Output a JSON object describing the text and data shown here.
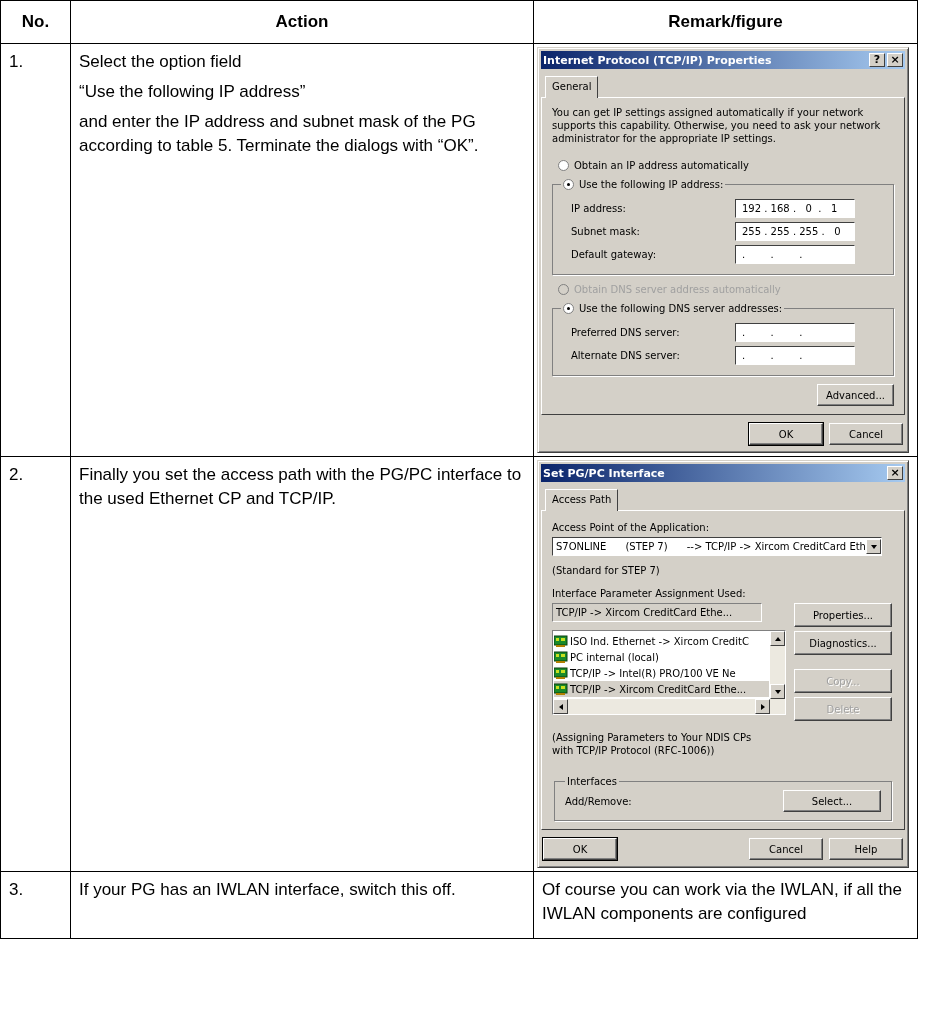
{
  "table": {
    "columns": [
      "No.",
      "Action",
      "Remark/figure"
    ],
    "rows": [
      {
        "no": "1.",
        "action": [
          "Select the option field",
          "“Use the following IP address”",
          "and enter the IP address and subnet mask of the PG according to table 5. Terminate the dialogs with “OK”."
        ],
        "figure": {
          "kind": "ip_dialog",
          "title": "Internet Protocol (TCP/IP) Properties",
          "help_button": "?",
          "close_button": "×",
          "tabs": [
            {
              "label": "General",
              "selected": true
            }
          ],
          "description": "You can get IP settings assigned automatically if your network supports this capability. Otherwise, you need to ask your network administrator for the appropriate IP settings.",
          "ip_options": [
            {
              "label": "Obtain an IP address automatically",
              "selected": false,
              "disabled": false
            },
            {
              "label": "Use the following IP address:",
              "selected": true,
              "disabled": false,
              "fields": [
                {
                  "label": "IP address:",
                  "value": "192 . 168 .   0  .   1"
                },
                {
                  "label": "Subnet mask:",
                  "value": "255 . 255 . 255 .   0"
                },
                {
                  "label": "Default gateway:",
                  "value": ".        .        ."
                }
              ]
            }
          ],
          "dns_options": [
            {
              "label": "Obtain DNS server address automatically",
              "selected": false,
              "disabled": true
            },
            {
              "label": "Use the following DNS server addresses:",
              "selected": true,
              "disabled": false,
              "fields": [
                {
                  "label": "Preferred DNS server:",
                  "value": ".        .        ."
                },
                {
                  "label": "Alternate DNS server:",
                  "value": ".        .        ."
                }
              ]
            }
          ],
          "advanced_button": "Advanced...",
          "ok_button": "OK",
          "cancel_button": "Cancel"
        }
      },
      {
        "no": "2.",
        "action": [
          "Finally you set the access path with the PG/PC interface to the used Ethernet CP and TCP/IP."
        ],
        "figure": {
          "kind": "pgpc_dialog",
          "title": "Set PG/PC Interface",
          "close_button": "×",
          "tabs": [
            {
              "label": "Access Path",
              "selected": true
            }
          ],
          "access_point_label": "Access Point of the Application:",
          "access_point_value": "S7ONLINE      (STEP 7)      --> TCP/IP -> Xircom CreditCard Eth",
          "standard_note": "(Standard for STEP 7)",
          "param_label": "Interface Parameter Assignment Used:",
          "param_value": "TCP/IP -> Xircom CreditCard Ethe...",
          "list_items": [
            {
              "label": "ISO Ind. Ethernet -> Xircom CreditC",
              "selected": false
            },
            {
              "label": "PC internal (local)",
              "selected": false
            },
            {
              "label": "TCP/IP -> Intel(R) PRO/100 VE Ne",
              "selected": false
            },
            {
              "label": "TCP/IP -> Xircom CreditCard Ethe...",
              "selected": true
            }
          ],
          "side_buttons": [
            {
              "label": "Properties...",
              "disabled": false
            },
            {
              "label": "Diagnostics...",
              "disabled": false
            },
            {
              "label": "Copy...",
              "disabled": true
            },
            {
              "label": "Delete",
              "disabled": true
            }
          ],
          "protocol_note": "(Assigning Parameters to Your NDIS CPs\nwith TCP/IP Protocol (RFC-1006))",
          "interfaces_legend": "Interfaces",
          "add_remove_label": "Add/Remove:",
          "select_button": "Select...",
          "ok_button": "OK",
          "cancel_button": "Cancel",
          "help_button": "Help"
        }
      },
      {
        "no": "3.",
        "action": [
          "If your PG has an IWLAN interface, switch this off."
        ],
        "figure": {
          "kind": "text",
          "text": "Of course you can work via the IWLAN, if all the IWLAN components are configured"
        }
      }
    ]
  }
}
